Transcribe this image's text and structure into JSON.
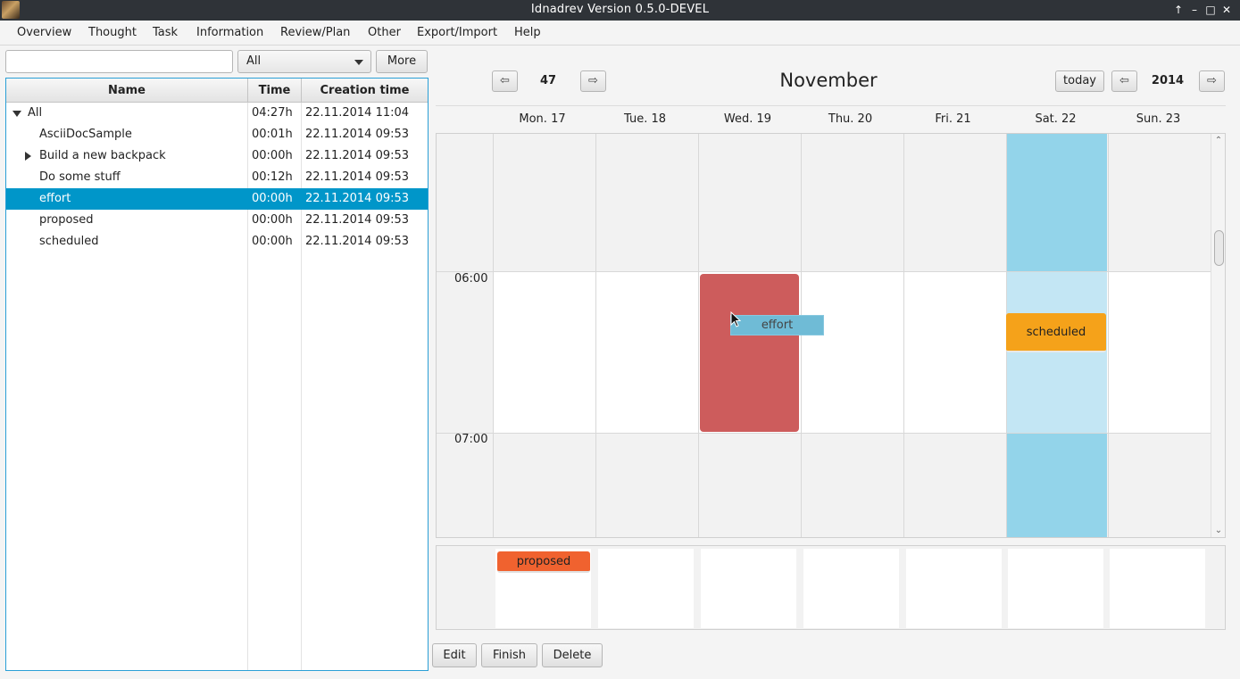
{
  "window": {
    "title": "Idnadrev Version 0.5.0-DEVEL"
  },
  "menu": [
    "Overview",
    "Thought",
    "Task",
    "Information",
    "Review/Plan",
    "Other",
    "Export/Import",
    "Help"
  ],
  "filter": {
    "search_value": "",
    "selected": "All",
    "more_label": "More"
  },
  "table": {
    "columns": [
      "Name",
      "Time",
      "Creation time"
    ],
    "rows": [
      {
        "name": "All",
        "time": "04:27h",
        "created": "22.11.2014 11:04",
        "expander": "expanded"
      },
      {
        "name": "AsciiDocSample",
        "time": "00:01h",
        "created": "22.11.2014 09:53"
      },
      {
        "name": "Build a new backpack",
        "time": "00:00h",
        "created": "22.11.2014 09:53",
        "expander": "collapsed"
      },
      {
        "name": "Do some stuff",
        "time": "00:12h",
        "created": "22.11.2014 09:53"
      },
      {
        "name": "effort",
        "time": "00:00h",
        "created": "22.11.2014 09:53",
        "selected": true
      },
      {
        "name": "proposed",
        "time": "00:00h",
        "created": "22.11.2014 09:53"
      },
      {
        "name": "scheduled",
        "time": "00:00h",
        "created": "22.11.2014 09:53"
      }
    ]
  },
  "calendar": {
    "prev_week_icon": "⇦",
    "next_week_icon": "⇨",
    "week": "47",
    "month": "November",
    "today_label": "today",
    "prev_year_icon": "⇦",
    "next_year_icon": "⇨",
    "year": "2014",
    "days": [
      "Mon. 17",
      "Tue. 18",
      "Wed. 19",
      "Thu. 20",
      "Fri. 21",
      "Sat. 22",
      "Sun. 23"
    ],
    "hours": [
      "06:00",
      "07:00"
    ],
    "events": {
      "effort": "effort",
      "scheduled": "scheduled",
      "proposed": "proposed"
    },
    "colors": {
      "selected_row": "#0096c9",
      "today_column": "#93d4ea",
      "effort_block": "#cd5c5c",
      "scheduled": "#f5a21a",
      "proposed": "#f0622f"
    }
  },
  "actions": {
    "edit": "Edit",
    "finish": "Finish",
    "delete": "Delete"
  }
}
